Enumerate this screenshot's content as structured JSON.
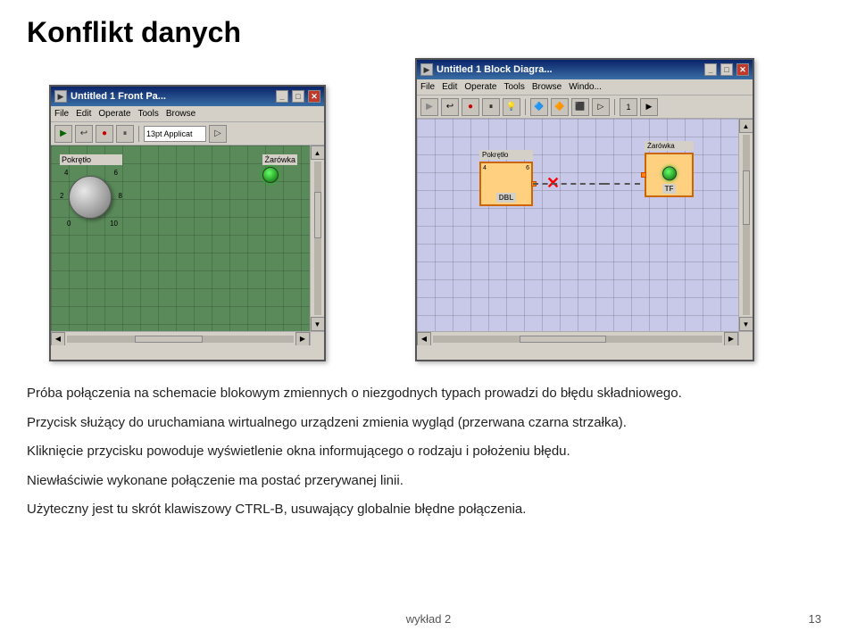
{
  "title": "Konflikt danych",
  "left_window": {
    "titlebar": "Untitled 1 Front Pa...",
    "title_icon": "▶",
    "menu_items": [
      "File",
      "Edit",
      "Operate",
      "Tools",
      "Browse"
    ],
    "toolbar_dropdown": "13pt Applicat",
    "canvas_label_knob": "Pokrętło",
    "canvas_label_bulb": "Żarówka",
    "knob_scale": {
      "top_left": "4",
      "top_right": "6",
      "mid_left": "2",
      "mid_right": "8",
      "bottom_left": "0",
      "bottom_right": "10"
    }
  },
  "right_window": {
    "titlebar": "Untitled 1 Block Diagra...",
    "title_icon": "▶",
    "menu_items": [
      "File",
      "Edit",
      "Operate",
      "Tools",
      "Browse",
      "Windo..."
    ],
    "node_knob_label": "Pokrętło",
    "node_knob_sub": "DBL",
    "node_bulb_label": "Żarówka",
    "node_bulb_sub": "TF"
  },
  "paragraphs": [
    "Próba połączenia na schemacie blokowym zmiennych o niezgodnych typach prowadzi do błędu składniowego.",
    "Przycisk służący do uruchamiana wirtualnego urządzeni zmienia wygląd (przerwana czarna strzałka).",
    "Kliknięcie przycisku powoduje wyświetlenie okna informującego o rodzaju i położeniu błędu.",
    "Niewłaściwie wykonane połączenie ma postać przerywanej linii.",
    "Użyteczny jest tu skrót klawiszowy CTRL-B, usuwający globalnie błędne połączenia."
  ],
  "footer": {
    "label": "wykład 2",
    "page": "13"
  }
}
